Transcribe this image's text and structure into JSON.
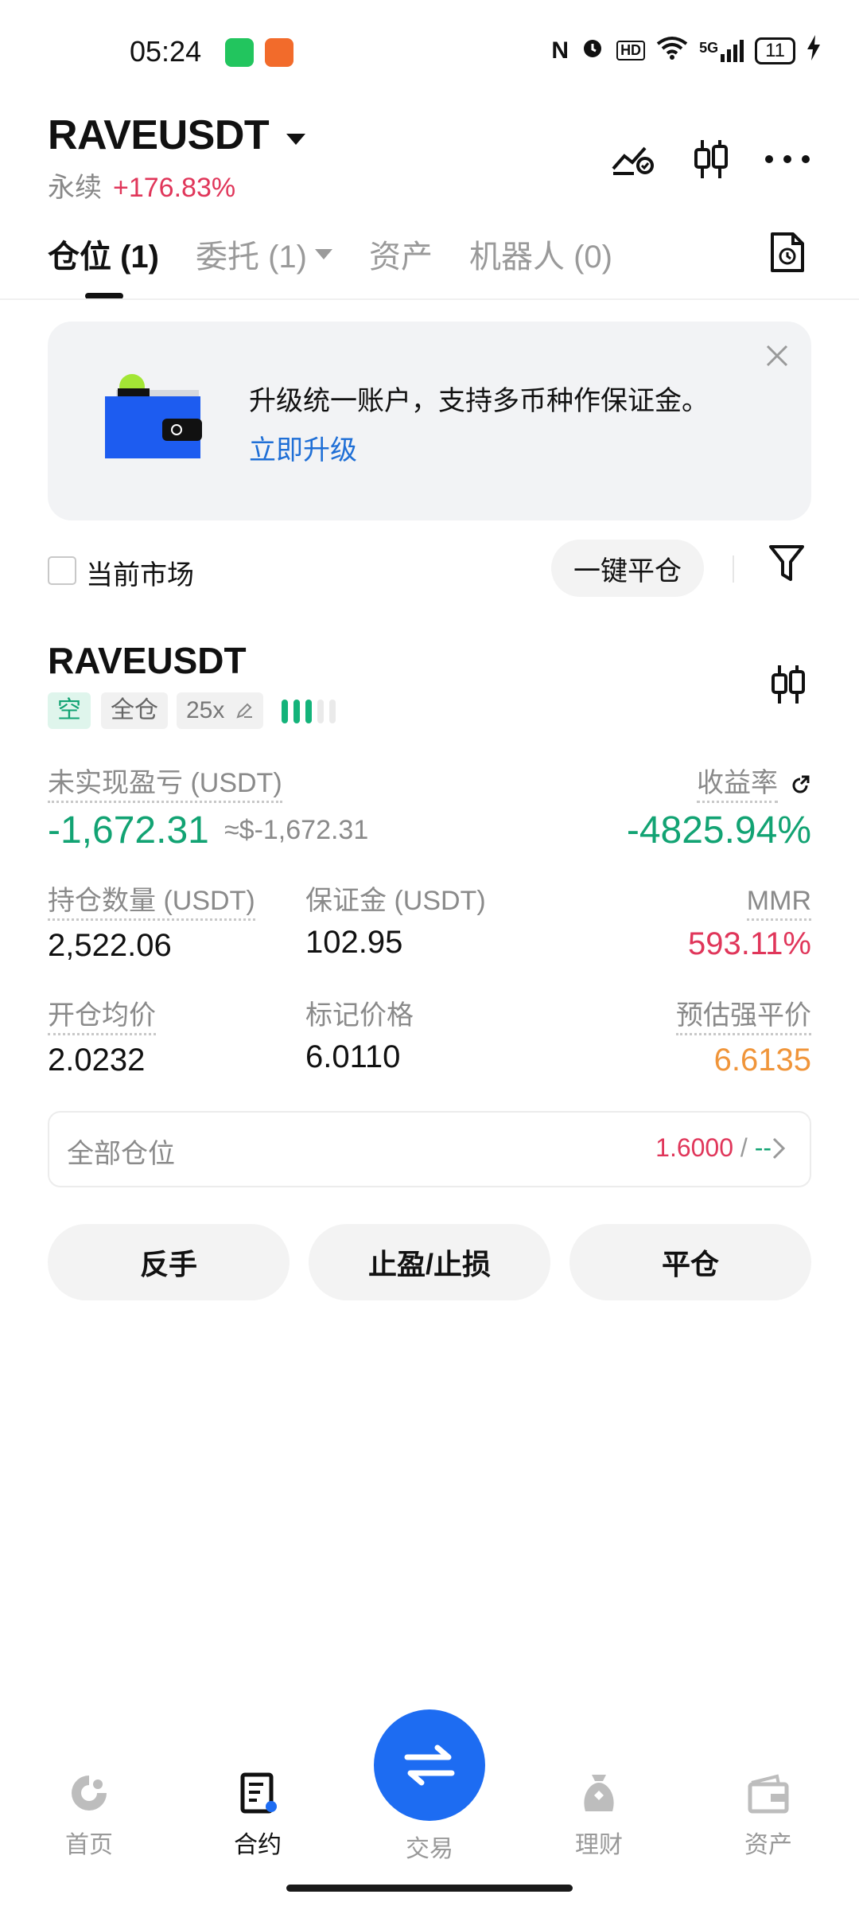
{
  "status_bar": {
    "time": "05:24",
    "network": "5G",
    "battery": "11"
  },
  "header": {
    "pair": "RAVEUSDT",
    "type": "永续",
    "change": "+176.83%"
  },
  "tabs": [
    {
      "label": "仓位 (1)",
      "active": true
    },
    {
      "label": "委托 (1)",
      "active": false
    },
    {
      "label": "资产",
      "active": false
    },
    {
      "label": "机器人 (0)",
      "active": false
    }
  ],
  "banner": {
    "text": "升级统一账户，支持多币种作保证金。",
    "link": "立即升级"
  },
  "filter": {
    "current_market": "当前市场",
    "close_all": "一键平仓"
  },
  "position": {
    "symbol": "RAVEUSDT",
    "side_tag": "空",
    "margin_tag": "全仓",
    "leverage_tag": "25x",
    "leverage_level_fraction": 0.6,
    "unrealized_label": "未实现盈亏 (USDT)",
    "unrealized_value": "-1,672.31",
    "unrealized_approx": "≈$-1,672.31",
    "roi_label": "收益率",
    "roi_value": "-4825.94%",
    "size_label": "持仓数量 (USDT)",
    "size_value": "2,522.06",
    "margin_label": "保证金 (USDT)",
    "margin_value": "102.95",
    "mmr_label": "MMR",
    "mmr_value": "593.11%",
    "entry_label": "开仓均价",
    "entry_value": "2.0232",
    "mark_label": "标记价格",
    "mark_value": "6.0110",
    "liq_label": "预估强平价",
    "liq_value": "6.6135",
    "all_positions_label": "全部仓位",
    "all_positions_value": "1.6000",
    "all_positions_sep": " / ",
    "all_positions_value2": "--",
    "actions": [
      "反手",
      "止盈/止损",
      "平仓"
    ]
  },
  "bottom_nav": [
    {
      "label": "首页",
      "icon": "home-icon"
    },
    {
      "label": "合约",
      "icon": "contract-icon"
    },
    {
      "label": "交易",
      "icon": "swap-icon"
    },
    {
      "label": "理财",
      "icon": "earn-icon"
    },
    {
      "label": "资产",
      "icon": "wallet-icon"
    }
  ],
  "colors": {
    "accent": "#1d6cf2",
    "positive": "#12a373",
    "negative": "#e0365a",
    "warning": "#f0953a"
  }
}
